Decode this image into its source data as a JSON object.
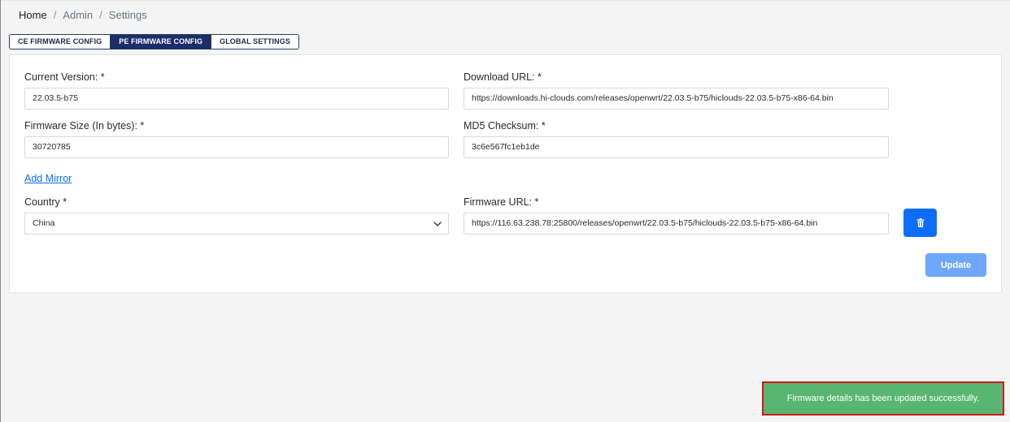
{
  "breadcrumb": {
    "home": "Home",
    "admin": "Admin",
    "settings": "Settings",
    "separator": "/"
  },
  "tabs": [
    {
      "label": "CE FIRMWARE CONFIG",
      "active": false
    },
    {
      "label": "PE FIRMWARE CONFIG",
      "active": true
    },
    {
      "label": "GLOBAL SETTINGS",
      "active": false
    }
  ],
  "form": {
    "current_version": {
      "label": "Current Version: *",
      "value": "22.03.5-b75"
    },
    "download_url": {
      "label": "Download URL: *",
      "value": "https://downloads.hi-clouds.com/releases/openwrt/22.03.5-b75/hiclouds-22.03.5-b75-x86-64.bin"
    },
    "firmware_size": {
      "label": "Firmware Size (In bytes): *",
      "value": "30720785"
    },
    "md5_checksum": {
      "label": "MD5 Checksum: *",
      "value": "3c6e567fc1eb1de"
    },
    "add_mirror": "Add Mirror",
    "country": {
      "label": "Country *",
      "value": "China"
    },
    "firmware_url": {
      "label": "Firmware URL: *",
      "value": "https://116.63.238.78:25800/releases/openwrt/22.03.5-b75/hiclouds-22.03.5-b75-x86-64.bin"
    },
    "update_button": "Update"
  },
  "toast": {
    "message": "Firmware details has been updated successfully."
  },
  "icons": {
    "delete": "trash-icon",
    "dropdown": "chevron-down-icon"
  },
  "colors": {
    "primary": "#0d6efd",
    "tab_active": "#1c2d6b",
    "update_disabled": "#6ea8fe",
    "toast_bg": "#59b672",
    "toast_border": "#d11a1a"
  }
}
